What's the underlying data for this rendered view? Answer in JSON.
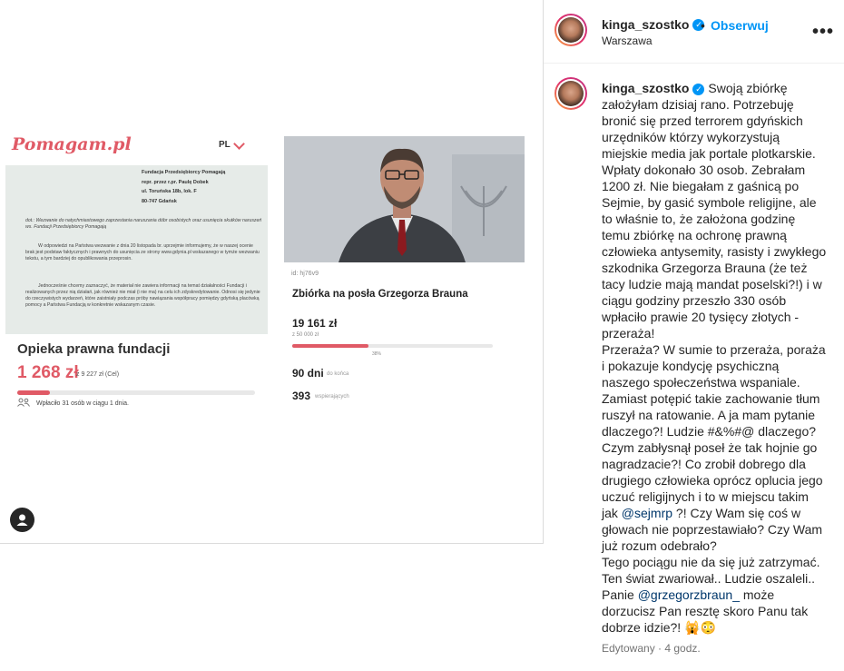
{
  "post": {
    "username": "kinga_szostko",
    "follow_label": "Obserwuj",
    "dot": "•",
    "location": "Warszawa",
    "more_label": "•••",
    "verified_mark": "✓"
  },
  "card1": {
    "logo": "Pomagam.pl",
    "lang": "PL",
    "letter_header": "Fundacja Przedsiębiorcy Pomagają\nrepr. przez r.pr. Paulę Dobek\nul. Toruńska 18b, lok. F\n80-747 Gdańsk",
    "letter_p1": "dot.: Wezwanie do natychmiastowego zaprzestania naruszania dóbr osobistych oraz usunięcia skutków naruszeń ws. Fundacji Przedsiębiorcy Pomagają",
    "letter_p2": "W odpowiedzi na Państwa wezwanie z dnia 20 listopada br. uprzejmie informujemy, że w naszej ocenie brak jest podstaw faktycznych i prawnych do usunięcia ze strony www.gdynia.pl wskazanego w tymże wezwaniu tekstu, a tym bardziej do opublikowania przeprosin.",
    "letter_p3": "Jednocześnie chcemy zaznaczyć, że materiał nie zawiera informacji na temat działalności Fundacji i realizowanych przez nią działań, jak również nie miał (i nie ma) na celu ich zdyskredytowanie. Odnosi się jedynie do rzeczywistych wydarzeń, które zaistniały podczas próby nawiązania współpracy pomiędzy gdyńską placówką pomocy a Państwa Fundacją w konkretnie wskazanym czasie.",
    "title": "Opieka prawna fundacji",
    "amount": "1 268 zł",
    "target": "z 9 227 zł (Cel)",
    "progress": 0.138,
    "supporters": "Wpłaciło 31 osób w ciągu 1 dnia."
  },
  "card2": {
    "id": "id: hj76v9",
    "title": "Zbiórka na posła Grzegorza Brauna",
    "amount": "19 161 zł",
    "target": "z 50 000 zł",
    "progress": 0.38,
    "pct": "38%",
    "days": "90 dni",
    "days_label": "do końca",
    "supporters": "393",
    "supporters_label": "wspierających"
  },
  "caption": {
    "username": "kinga_szostko",
    "part1": " Swoją zbiórkę założyłam dzisiaj rano. Potrzebuję bronić się przed terrorem gdyńskich urzędników którzy wykorzystują miejskie media jak portale plotkarskie. Wpłaty dokonało 30 osob. Zebrałam 1200 zł. Nie biegałam z gaśnicą po Sejmie, by gasić symbole religijne, ale to właśnie to, że założona godzinę temu zbiórkę na ochronę prawną człowieka antysemity, rasisty i zwykłego szkodnika Grzegorza Brauna (że też tacy ludzie mają mandat poselski?!) i w ciągu godziny przeszło 330 osób wpłaciło prawie 20 tysięcy złotych - przeraża!",
    "part2": "Przeraża? W sumie to przeraża, poraża i pokazuje kondycję psychiczną naszego społeczeństwa wspaniale. Zamiast potępić takie zachowanie tłum ruszył na ratowanie. A ja mam pytanie dlaczego?! Ludzie #&%#@ dlaczego? Czym zabłysnął poseł że tak hojnie go nagradzacie?! Co zrobił dobrego dla drugiego człowieka oprócz oplucia jego uczuć religijnych i to w miejscu takim jak ",
    "mention1": "@sejmrp",
    "part3": " ?! Czy Wam się coś w głowach nie poprzestawiało? Czy Wam już rozum odebrało?",
    "part4": "Tego pociągu nie da się już zatrzymać. Ten świat zwariował.. Ludzie oszaleli..",
    "part5": "Panie ",
    "mention2": "@grzegorzbraun_",
    "part6": " może dorzucisz Pan resztę skoro Panu tak dobrze idzie?! 🙀😳",
    "edited": "Edytowany · 4 godz."
  },
  "colors": {
    "accent": "#e05a66",
    "link": "#0095f6"
  }
}
